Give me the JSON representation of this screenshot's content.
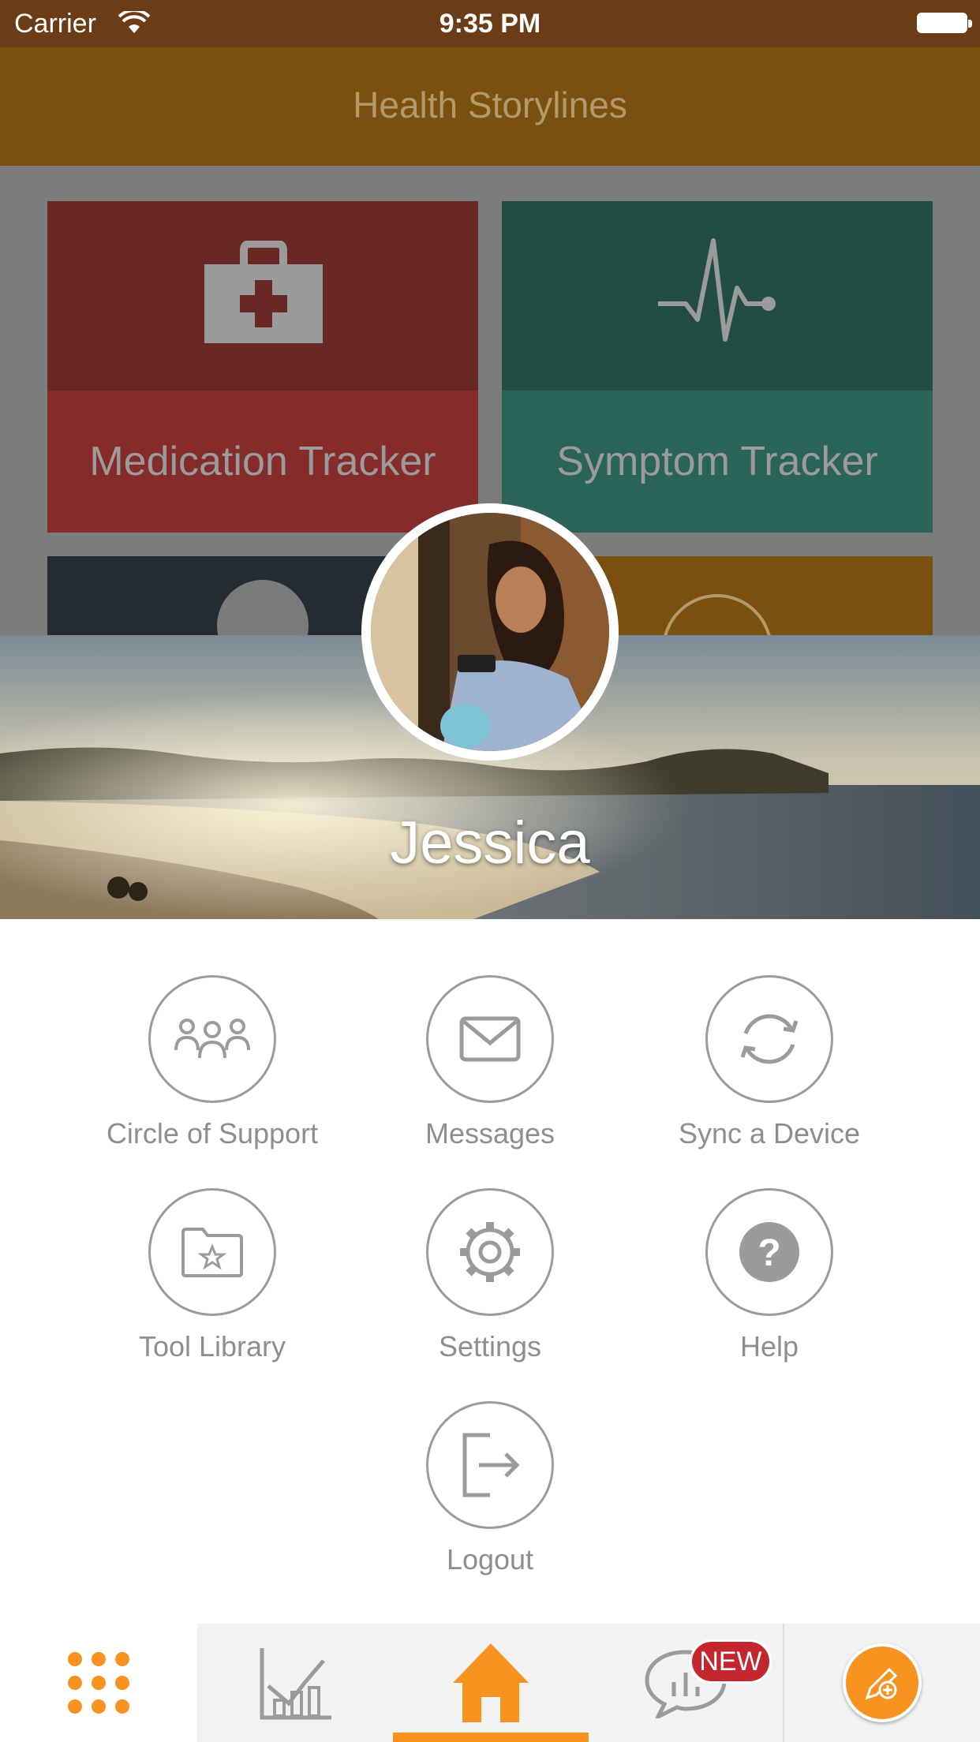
{
  "status_bar": {
    "carrier": "Carrier",
    "time": "9:35 PM"
  },
  "header": {
    "title": "Health Storylines"
  },
  "tiles": [
    {
      "label": "Medication Tracker",
      "icon": "medical-kit-icon",
      "top_color": "#692823",
      "bottom_color": "#852c2a"
    },
    {
      "label": "Symptom Tracker",
      "icon": "heartbeat-icon",
      "top_color": "#214d44",
      "bottom_color": "#2a6458"
    }
  ],
  "profile": {
    "name": "Jessica"
  },
  "menu": {
    "items": [
      {
        "label": "Circle of Support",
        "icon": "people-icon"
      },
      {
        "label": "Messages",
        "icon": "envelope-icon"
      },
      {
        "label": "Sync a Device",
        "icon": "sync-icon"
      },
      {
        "label": "Tool Library",
        "icon": "folder-star-icon"
      },
      {
        "label": "Settings",
        "icon": "gear-icon"
      },
      {
        "label": "Help",
        "icon": "question-icon"
      },
      {
        "label": "Logout",
        "icon": "logout-icon"
      }
    ]
  },
  "tab_bar": {
    "new_badge": "NEW",
    "accent": "#f7931e",
    "tabs": [
      "grid-menu-icon",
      "chart-icon",
      "home-icon",
      "chat-chart-icon",
      "add-note-icon"
    ],
    "selected": "home-icon"
  }
}
